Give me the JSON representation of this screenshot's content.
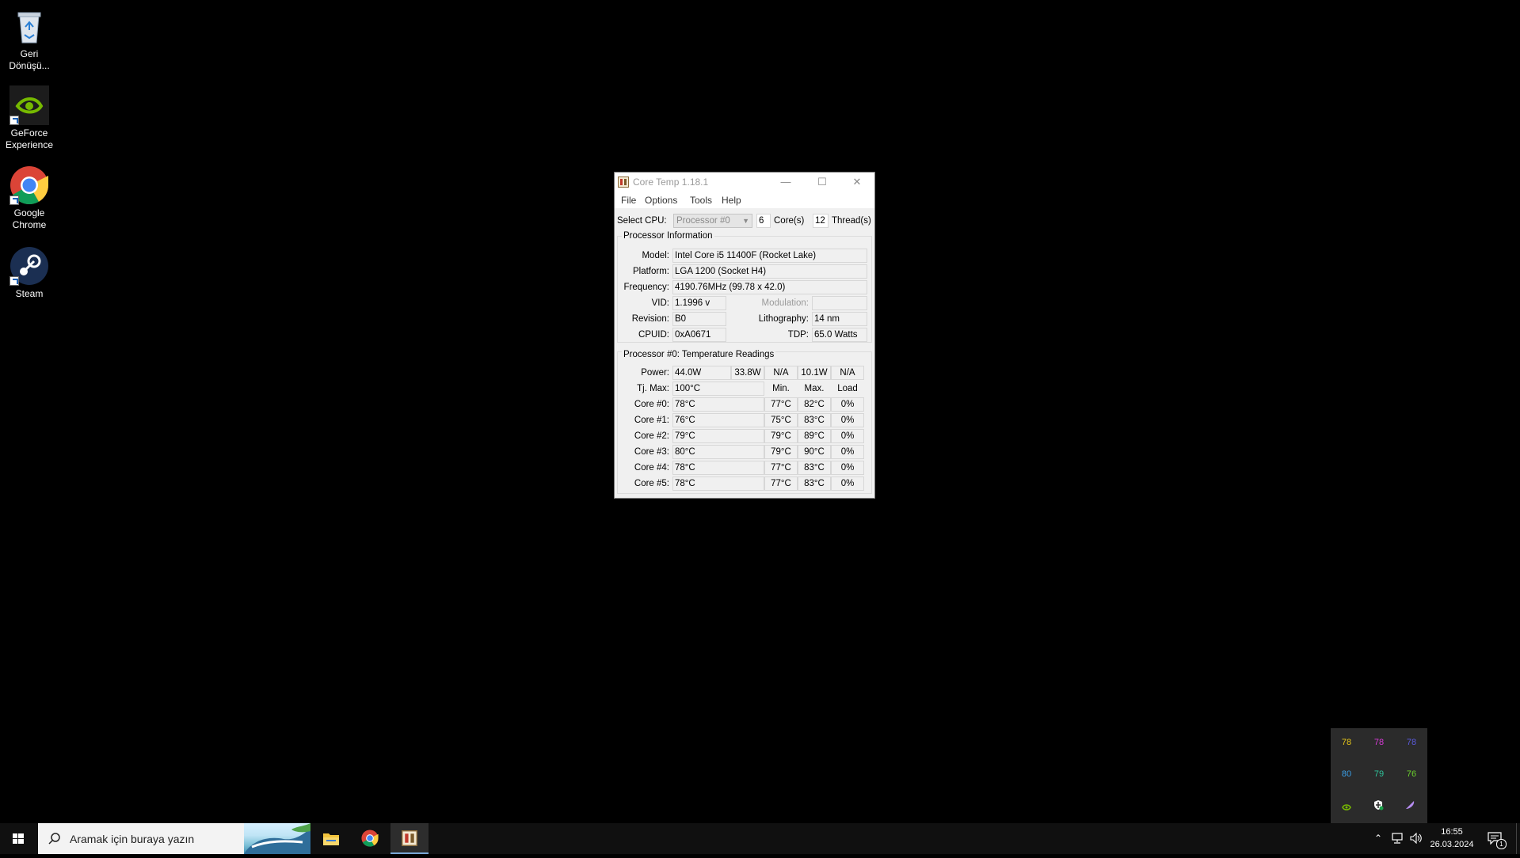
{
  "desktop": {
    "icons": [
      {
        "label_line1": "Geri",
        "label_line2": "Dönüşü..."
      },
      {
        "label_line1": "GeForce",
        "label_line2": "Experience"
      },
      {
        "label_line1": "Google",
        "label_line2": "Chrome"
      },
      {
        "label_line1": "Steam",
        "label_line2": ""
      }
    ]
  },
  "window": {
    "title": "Core Temp 1.18.1",
    "menu": [
      "File",
      "Options",
      "Tools",
      "Help"
    ],
    "select_cpu_label": "Select CPU:",
    "processor_select": "Processor #0",
    "cores_value": "6",
    "cores_label": "Core(s)",
    "threads_value": "12",
    "threads_label": "Thread(s)",
    "processor_info": {
      "group_title": "Processor Information",
      "model_label": "Model:",
      "model": "Intel Core i5 11400F (Rocket Lake)",
      "platform_label": "Platform:",
      "platform": "LGA 1200 (Socket H4)",
      "frequency_label": "Frequency:",
      "frequency": "4190.76MHz (99.78 x 42.0)",
      "vid_label": "VID:",
      "vid": "1.1996 v",
      "modulation_label": "Modulation:",
      "modulation": "",
      "revision_label": "Revision:",
      "revision": "B0",
      "lithography_label": "Lithography:",
      "lithography": "14 nm",
      "cpuid_label": "CPUID:",
      "cpuid": "0xA0671",
      "tdp_label": "TDP:",
      "tdp": "65.0 Watts"
    },
    "temps": {
      "group_title": "Processor #0: Temperature Readings",
      "power_label": "Power:",
      "power": [
        "44.0W",
        "33.8W",
        "N/A",
        "10.1W",
        "N/A"
      ],
      "tjmax_label": "Tj. Max:",
      "tjmax": "100°C",
      "col_min": "Min.",
      "col_max": "Max.",
      "col_load": "Load",
      "cores": [
        {
          "label": "Core #0:",
          "temp": "78°C",
          "min": "77°C",
          "max": "82°C",
          "load": "0%"
        },
        {
          "label": "Core #1:",
          "temp": "76°C",
          "min": "75°C",
          "max": "83°C",
          "load": "0%"
        },
        {
          "label": "Core #2:",
          "temp": "79°C",
          "min": "79°C",
          "max": "89°C",
          "load": "0%"
        },
        {
          "label": "Core #3:",
          "temp": "80°C",
          "min": "79°C",
          "max": "90°C",
          "load": "0%"
        },
        {
          "label": "Core #4:",
          "temp": "78°C",
          "min": "77°C",
          "max": "83°C",
          "load": "0%"
        },
        {
          "label": "Core #5:",
          "temp": "78°C",
          "min": "77°C",
          "max": "83°C",
          "load": "0%"
        }
      ]
    }
  },
  "taskbar": {
    "search_placeholder": "Aramak için buraya yazın",
    "time": "16:55",
    "date": "26.03.2024",
    "notification_count": "1"
  },
  "tray_popup": {
    "temps": [
      {
        "value": "78",
        "color": "#e6c619"
      },
      {
        "value": "78",
        "color": "#d63ad6"
      },
      {
        "value": "78",
        "color": "#5a5adc"
      },
      {
        "value": "80",
        "color": "#3a9ee6"
      },
      {
        "value": "79",
        "color": "#2ec29a"
      },
      {
        "value": "76",
        "color": "#6cd22e"
      }
    ],
    "icons": [
      "nvidia-icon",
      "defender-icon",
      "feather-icon"
    ]
  }
}
